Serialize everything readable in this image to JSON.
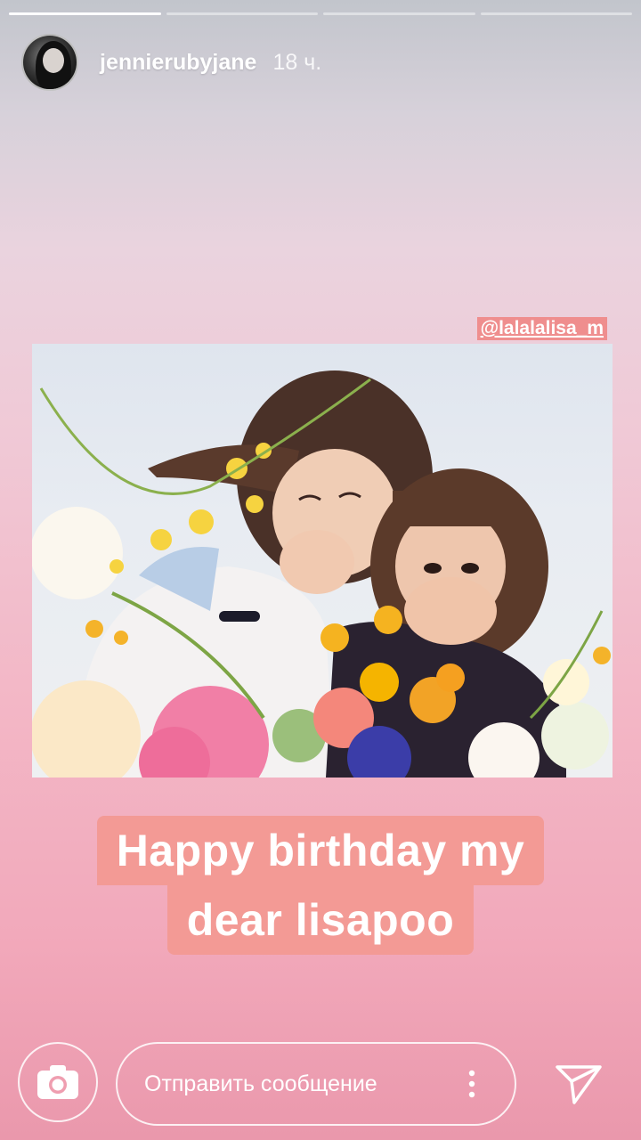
{
  "story": {
    "progress": [
      1.0,
      0.0,
      0.0,
      0.0
    ],
    "username": "jennierubyjane",
    "time": "18 ч."
  },
  "mention": "@lalalalisa_m",
  "caption": {
    "line1": "Happy birthday my",
    "line2": "dear lisapoo"
  },
  "composer": {
    "placeholder": "Отправить сообщение",
    "camera_icon": "camera-icon",
    "more_icon": "more-vertical-icon",
    "send_icon": "send-icon"
  },
  "colors": {
    "caption_bg": "#f39a95",
    "mention_bg": "#ef8e8e"
  }
}
